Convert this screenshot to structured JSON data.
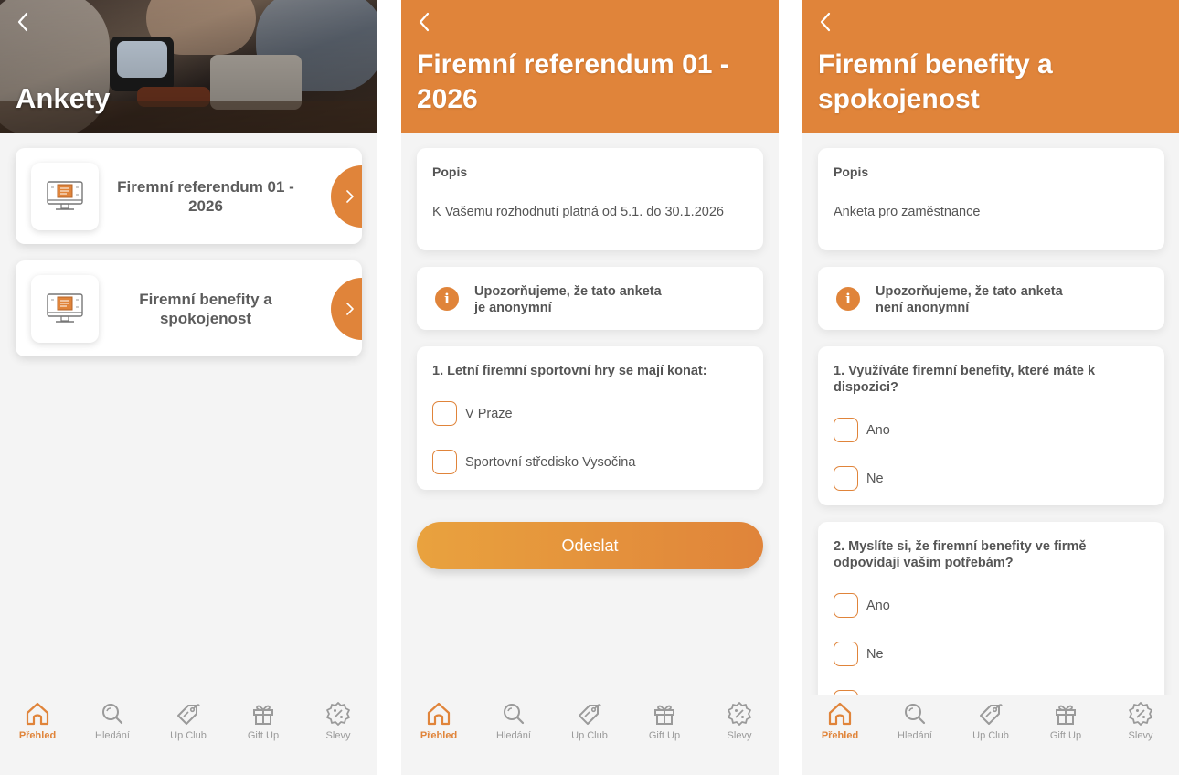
{
  "colors": {
    "accent": "#e0843a",
    "background": "#f4f4f4",
    "card": "#ffffff",
    "text": "#555555",
    "muted": "#9a9a9a"
  },
  "screen1": {
    "title": "Ankety",
    "surveys": [
      {
        "title": "Firemní referendum 01 - 2026",
        "icon": "computer-icon"
      },
      {
        "title": "Firemní benefity a spokojenost",
        "icon": "computer-icon"
      }
    ]
  },
  "screen2": {
    "title": "Firemní referendum 01 - 2026",
    "description_label": "Popis",
    "description": "K Vašemu rozhodnutí platná od 5.1. do 30.1.2026",
    "notice_line1": "Upozorňujeme, že tato anketa",
    "notice_line2": "je anonymní",
    "question1": {
      "text": "1. Letní firemní sportovní hry se mají konat:",
      "options": [
        "V Praze",
        "Sportovní středisko Vysočina"
      ]
    },
    "submit_label": "Odeslat"
  },
  "screen3": {
    "title": "Firemní benefity a spokojenost",
    "description_label": "Popis",
    "description": "Anketa pro zaměstnance",
    "notice_line1": "Upozorňujeme, že tato anketa",
    "notice_line2": "není anonymní",
    "question1": {
      "text": "1. Využíváte firemní benefity, které máte k dispozici?",
      "options": [
        "Ano",
        "Ne"
      ]
    },
    "question2": {
      "text": "2. Myslíte si, že firemní benefity ve firmě odpovídají vašim potřebám?",
      "options": [
        "Ano",
        "Ne"
      ]
    }
  },
  "tabbar": {
    "items": [
      {
        "label": "Přehled",
        "icon": "home-icon",
        "active": true
      },
      {
        "label": "Hledání",
        "icon": "search-icon",
        "active": false
      },
      {
        "label": "Up Club",
        "icon": "tag-icon",
        "active": false
      },
      {
        "label": "Gift Up",
        "icon": "gift-icon",
        "active": false
      },
      {
        "label": "Slevy",
        "icon": "discount-icon",
        "active": false
      }
    ]
  }
}
